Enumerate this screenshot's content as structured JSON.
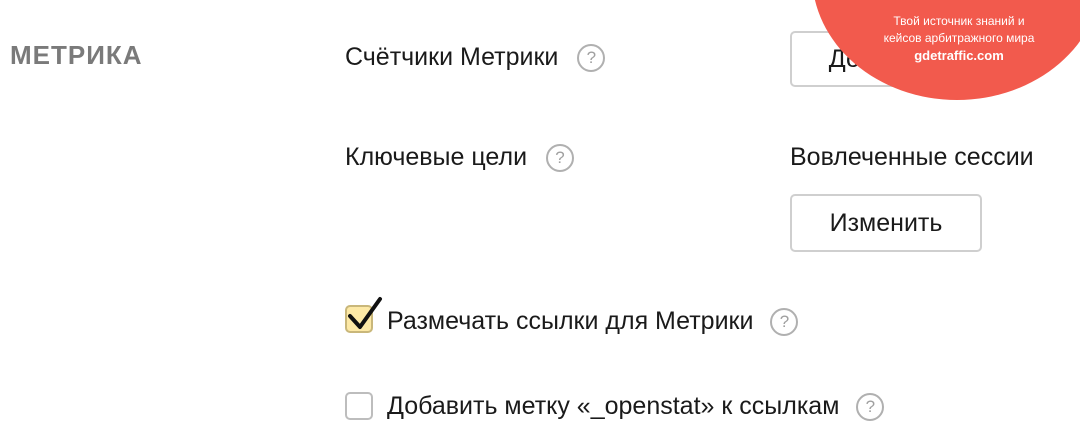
{
  "section": {
    "title": "МЕТРИКА"
  },
  "counters": {
    "label": "Счётчики Метрики",
    "help": "?",
    "add_button": "Добавить"
  },
  "goals": {
    "label": "Ключевые цели",
    "help": "?",
    "value": "Вовлеченные сессии",
    "change_button": "Изменить"
  },
  "options": [
    {
      "label": "Размечать ссылки для Метрики",
      "checked": true,
      "help": "?"
    },
    {
      "label": "Добавить метку «_openstat» к ссылкам",
      "checked": false,
      "help": "?"
    }
  ],
  "promo": {
    "line1": "Твой источник знаний и",
    "line2": "кейсов арбитражного мира",
    "brand": "gdetraffic.com"
  },
  "colors": {
    "accent": "#f25a4d",
    "checkbox_checked_bg": "#fde9a6"
  },
  "icons": {
    "help": "question-circle-icon",
    "check": "checkmark-icon"
  }
}
